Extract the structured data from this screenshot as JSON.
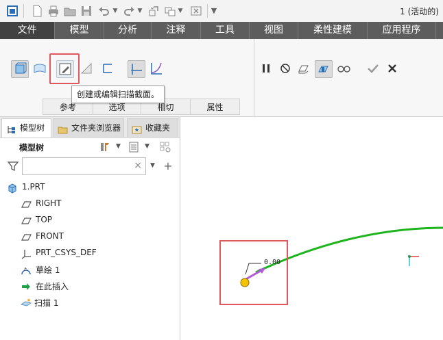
{
  "window": {
    "title": "1 (活动的)"
  },
  "quick_access": {
    "icons": [
      "window-icon",
      "new-icon",
      "print-icon",
      "open-icon",
      "save-icon",
      "undo-icon",
      "redo-icon",
      "regenerate-icon",
      "switch-window-icon",
      "close-window-icon",
      "customize-icon"
    ]
  },
  "tabs": [
    {
      "label": "文件",
      "active": true
    },
    {
      "label": "模型",
      "active": false
    },
    {
      "label": "分析",
      "active": false
    },
    {
      "label": "注释",
      "active": false
    },
    {
      "label": "工具",
      "active": false
    },
    {
      "label": "视图",
      "active": false
    },
    {
      "label": "柔性建模",
      "active": false
    },
    {
      "label": "应用程序",
      "active": false
    }
  ],
  "ribbon": {
    "sweep_type_icons": [
      "solid-sweep-icon",
      "surface-sweep-icon"
    ],
    "section_tools": [
      "sketch-section-icon",
      "remove-material-icon",
      "thicken-icon",
      "constant-section-icon",
      "variable-section-icon"
    ],
    "control_icons": [
      "pause-icon",
      "no-preview-icon",
      "preview-icon",
      "verify-icon",
      "glasses-icon",
      "ok-icon",
      "cancel-icon"
    ],
    "group_tabs": [
      "参考",
      "选项",
      "相切",
      "属性"
    ]
  },
  "tooltip": {
    "text": "创建或编辑扫描截面。"
  },
  "panel": {
    "tabs": [
      {
        "label": "模型树",
        "active": true
      },
      {
        "label": "文件夹浏览器",
        "active": false
      },
      {
        "label": "收藏夹",
        "active": false
      }
    ],
    "header": "模型树",
    "filter": {
      "value": "",
      "placeholder": ""
    },
    "tree": [
      {
        "label": "1.PRT",
        "icon": "part-icon"
      },
      {
        "label": "RIGHT",
        "icon": "datum-plane-icon"
      },
      {
        "label": "TOP",
        "icon": "datum-plane-icon"
      },
      {
        "label": "FRONT",
        "icon": "datum-plane-icon"
      },
      {
        "label": "PRT_CSYS_DEF",
        "icon": "csys-icon"
      },
      {
        "label": "草绘 1",
        "icon": "sketch-icon"
      },
      {
        "label": "在此插入",
        "icon": "insert-here-icon"
      },
      {
        "label": "扫描 1",
        "icon": "sweep-feature-icon"
      }
    ]
  },
  "graphics": {
    "start_point_label": "0.00",
    "colors": {
      "trajectory": "#1db41d",
      "start_point": "#f4c400",
      "arrow": "#b35ad6",
      "highlight": "#e2575e"
    }
  }
}
